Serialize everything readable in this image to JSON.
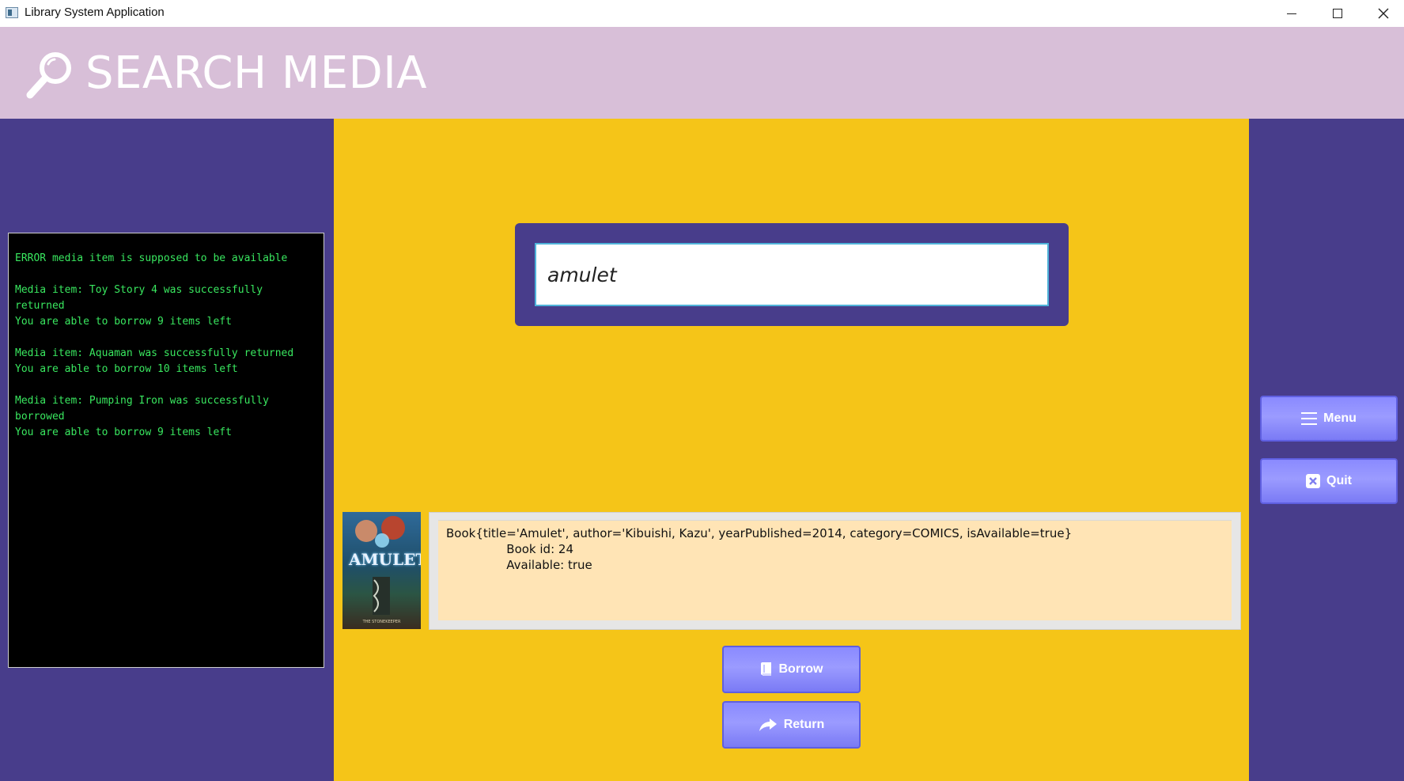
{
  "window": {
    "title": "Library System Application",
    "icon": "app-icon",
    "controls": [
      "minimize-icon",
      "maximize-icon",
      "close-icon"
    ]
  },
  "header": {
    "title": "SEARCH MEDIA",
    "icon": "search-icon"
  },
  "console": {
    "lines": [
      "ERROR media item is supposed to be available",
      "",
      "Media item: Toy Story 4 was successfully returned",
      "You are able to borrow 9 items left",
      "",
      "Media item: Aquaman was successfully returned",
      "You are able to borrow 10 items left",
      "",
      "Media item: Pumping Iron was successfully",
      "borrowed",
      "You are able to borrow 9 items left"
    ]
  },
  "search": {
    "value": "amulet"
  },
  "side_buttons": {
    "menu_label": "Menu",
    "quit_label": "Quit"
  },
  "result": {
    "cover_title": "AMULET",
    "cover_subtitle": "THE STONEKEEPER",
    "details": "Book{title='Amulet', author='Kibuishi, Kazu', yearPublished=2014, category=COMICS, isAvailable=true}\n                Book id: 24\n                Available: true"
  },
  "actions": {
    "borrow_label": "Borrow",
    "return_label": "Return"
  },
  "colors": {
    "header_bg": "#d8bfd8",
    "side_bg": "#483d8b",
    "center_bg": "#f5c518",
    "console_text": "#39e75f",
    "result_bg": "#ffe4b5",
    "button_bg": "#8a8aff"
  }
}
